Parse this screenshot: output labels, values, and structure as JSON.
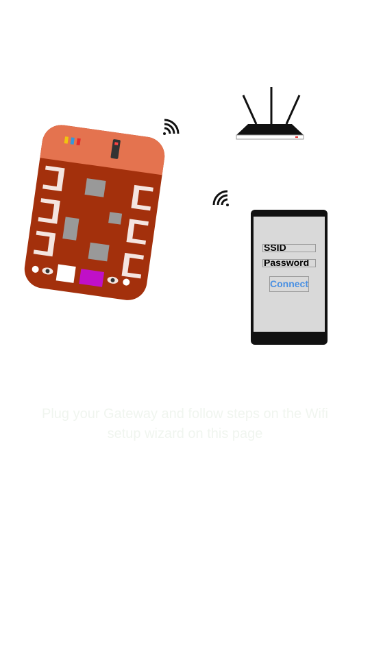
{
  "phone": {
    "ssid_label": "SSID",
    "password_label": "Password",
    "connect_label": "Connect",
    "link_color": "#4a90e2"
  },
  "caption": {
    "text": "Plug your Gateway and follow steps on the Wifi setup wizard on this page"
  },
  "icons": {
    "board": "circuit-board-icon",
    "router": "wifi-router-icon",
    "signal_board": "wifi-signal-icon",
    "signal_phone": "wifi-signal-icon",
    "phone": "smartphone-icon"
  },
  "colors": {
    "board_body": "#a3300c",
    "board_header": "#e4734f",
    "connector": "#f4e5e0",
    "chip": "#999999",
    "usb_port": "#c010c8",
    "caption_text": "#f0f5ef"
  }
}
